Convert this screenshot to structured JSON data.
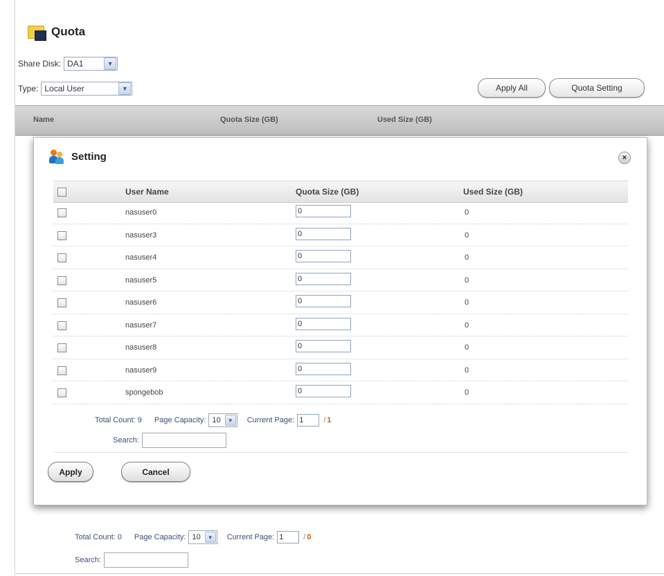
{
  "page": {
    "title": "Quota",
    "share_disk_label": "Share Disk:",
    "share_disk_value": "DA1",
    "type_label": "Type:",
    "type_value": "Local User",
    "apply_all_label": "Apply All",
    "quota_setting_label": "Quota Setting"
  },
  "background_table": {
    "columns": [
      "Name",
      "Quota Size (GB)",
      "Used Size (GB)"
    ],
    "pager": {
      "total_count_label": "Total Count: 0",
      "page_capacity_label": "Page Capacity:",
      "page_capacity_value": "10",
      "current_page_label": "Current Page:",
      "current_page_value": "1",
      "slash": "/",
      "total_pages": "0",
      "search_label": "Search:"
    }
  },
  "modal": {
    "title": "Setting",
    "close_glyph": "×",
    "columns": {
      "user": "User Name",
      "quota": "Quota Size (GB)",
      "used": "Used Size (GB)"
    },
    "rows": [
      {
        "user": "nasuser0",
        "quota": "0",
        "used": "0"
      },
      {
        "user": "nasuser3",
        "quota": "0",
        "used": "0"
      },
      {
        "user": "nasuser4",
        "quota": "0",
        "used": "0"
      },
      {
        "user": "nasuser5",
        "quota": "0",
        "used": "0"
      },
      {
        "user": "nasuser6",
        "quota": "0",
        "used": "0"
      },
      {
        "user": "nasuser7",
        "quota": "0",
        "used": "0"
      },
      {
        "user": "nasuser8",
        "quota": "0",
        "used": "0"
      },
      {
        "user": "nasuser9",
        "quota": "0",
        "used": "0"
      },
      {
        "user": "spongebob",
        "quota": "0",
        "used": "0"
      }
    ],
    "pager": {
      "total_count_label": "Total Count: 9",
      "page_capacity_label": "Page Capacity:",
      "page_capacity_value": "10",
      "current_page_label": "Current Page:",
      "current_page_value": "1",
      "slash": "/",
      "total_pages": "1",
      "search_label": "Search:"
    },
    "apply_label": "Apply",
    "cancel_label": "Cancel"
  },
  "icons": {
    "title_icon": "folder-icon",
    "modal_icon": "users-icon",
    "dropdown": "chevron-down-icon"
  },
  "colors": {
    "accent_orange": "#d25a00",
    "link_blue": "#3a4e78"
  }
}
